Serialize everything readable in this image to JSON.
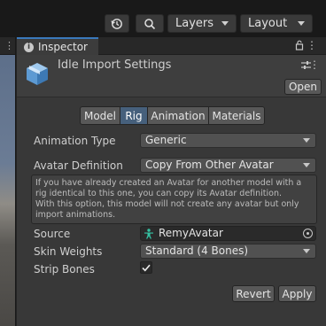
{
  "toolbar": {
    "history_icon": "history-icon",
    "search_icon": "search-icon",
    "layers_label": "Layers",
    "layout_label": "Layout"
  },
  "inspector": {
    "tab_label": "Inspector",
    "title": "Idle Import Settings",
    "open_label": "Open"
  },
  "tabs": [
    {
      "label": "Model",
      "active": false
    },
    {
      "label": "Rig",
      "active": true
    },
    {
      "label": "Animation",
      "active": false
    },
    {
      "label": "Materials",
      "active": false
    }
  ],
  "fields": {
    "animation_type": {
      "label": "Animation Type",
      "value": "Generic"
    },
    "avatar_definition": {
      "label": "Avatar Definition",
      "value": "Copy From Other Avatar"
    },
    "help_lines": [
      "If you have already created an Avatar for another model with a",
      "rig identical to this one, you can copy its Avatar definition.",
      "With this option, this model will not create any avatar but only",
      "import animations."
    ],
    "source": {
      "label": "Source",
      "value": "RemyAvatar"
    },
    "skin_weights": {
      "label": "Skin Weights",
      "value": "Standard (4 Bones)"
    },
    "strip_bones": {
      "label": "Strip Bones",
      "checked": true
    }
  },
  "buttons": {
    "revert": "Revert",
    "apply": "Apply"
  },
  "colors": {
    "accent": "#3a79bb",
    "active_tab": "#46607c",
    "avatar_icon": "#35c3a4"
  }
}
